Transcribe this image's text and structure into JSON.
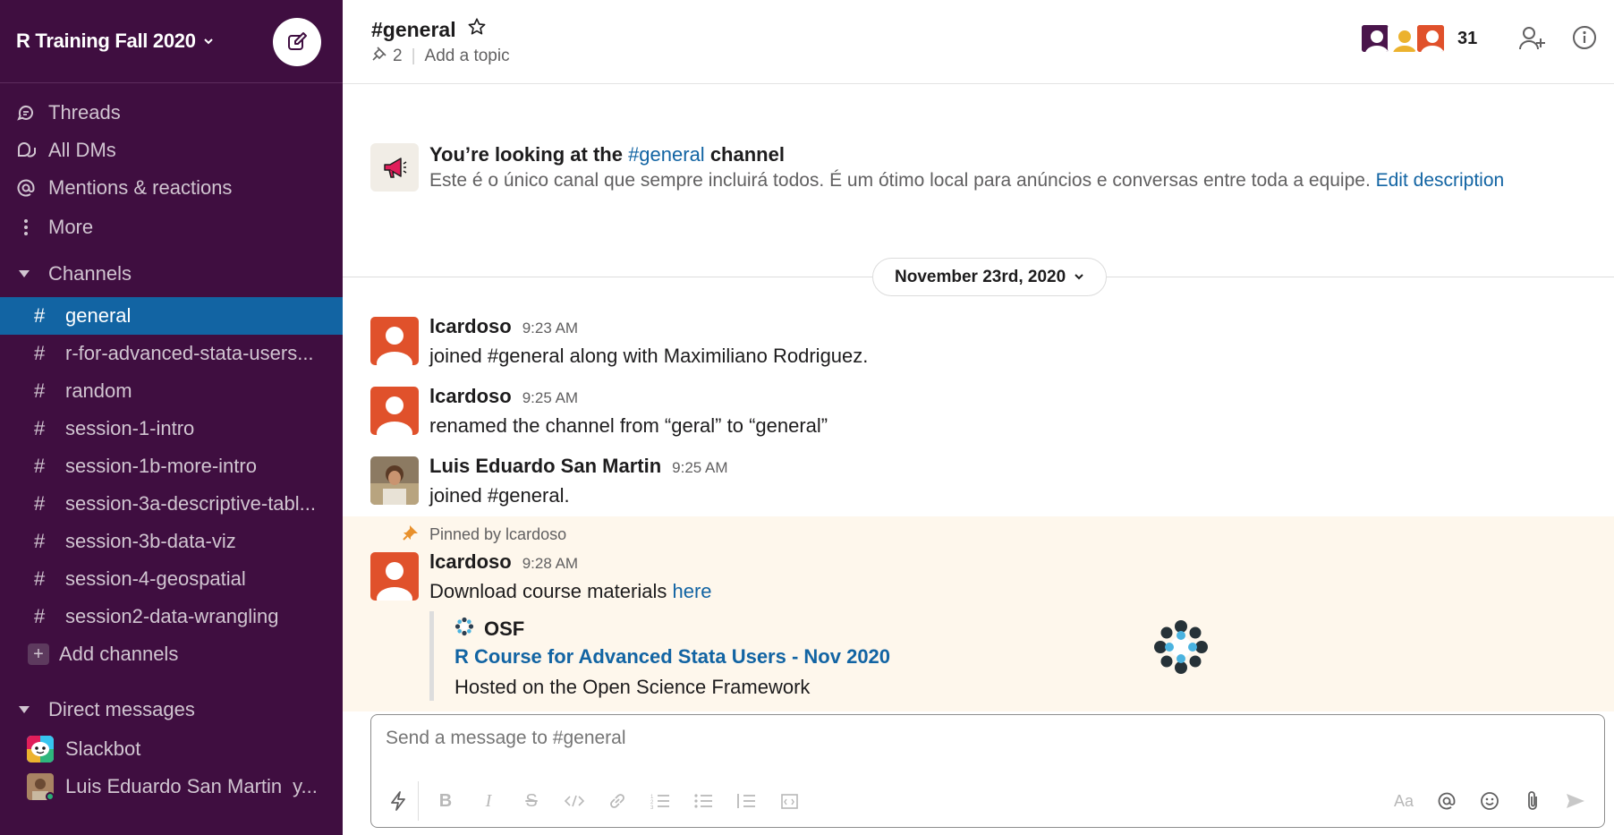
{
  "workspace": {
    "name": "R Training Fall 2020"
  },
  "nav": [
    {
      "label": "Threads",
      "icon": "threads-icon"
    },
    {
      "label": "All DMs",
      "icon": "dms-icon"
    },
    {
      "label": "Mentions & reactions",
      "icon": "at-icon"
    },
    {
      "label": "More",
      "icon": "more-vertical-icon"
    }
  ],
  "channels_section": {
    "label": "Channels"
  },
  "channels": [
    {
      "name": "general",
      "active": true
    },
    {
      "name": "r-for-advanced-stata-users..."
    },
    {
      "name": "random"
    },
    {
      "name": "session-1-intro"
    },
    {
      "name": "session-1b-more-intro"
    },
    {
      "name": "session-3a-descriptive-tabl..."
    },
    {
      "name": "session-3b-data-viz"
    },
    {
      "name": "session-4-geospatial"
    },
    {
      "name": "session2-data-wrangling"
    }
  ],
  "add_channels": "Add channels",
  "dm_section": {
    "label": "Direct messages"
  },
  "dms": [
    {
      "name": "Slackbot"
    },
    {
      "name": "Luis Eduardo San Martin",
      "suffix": "y..."
    }
  ],
  "channel": {
    "title": "#general",
    "pins": "2",
    "topic": "Add a topic",
    "member_count": "31"
  },
  "intro": {
    "title_pre": "You’re looking at the ",
    "title_link": "#general",
    "title_post": " channel",
    "desc": "Este é o único canal que sempre incluirá todos. É um ótimo local para anúncios e conversas entre toda a equipe. ",
    "desc_link": "Edit description"
  },
  "date_divider": "November 23rd, 2020",
  "messages": [
    {
      "name": "lcardoso",
      "time": "9:23 AM",
      "text": "joined #general along with Maximiliano Rodriguez."
    },
    {
      "name": "lcardoso",
      "time": "9:25 AM",
      "text": "renamed the channel from “geral” to “general”"
    },
    {
      "name": "Luis Eduardo San Martin",
      "time": "9:25 AM",
      "text": "joined #general."
    },
    {
      "name": "lcardoso",
      "time": "9:28 AM",
      "text": "Download course materials ",
      "link": "here"
    }
  ],
  "pinned_label": "Pinned by lcardoso",
  "attachment": {
    "service": "OSF",
    "title": "R Course for Advanced Stata Users - Nov 2020",
    "description": "Hosted on the Open Science Framework"
  },
  "composer": {
    "placeholder": "Send a message to #general"
  },
  "toolbar_text": {
    "format": "Aa"
  },
  "colors": {
    "sidebar": "#3f0e40",
    "active": "#1264a3",
    "link": "#1264a3",
    "pinned_bg": "#fef7ec"
  }
}
